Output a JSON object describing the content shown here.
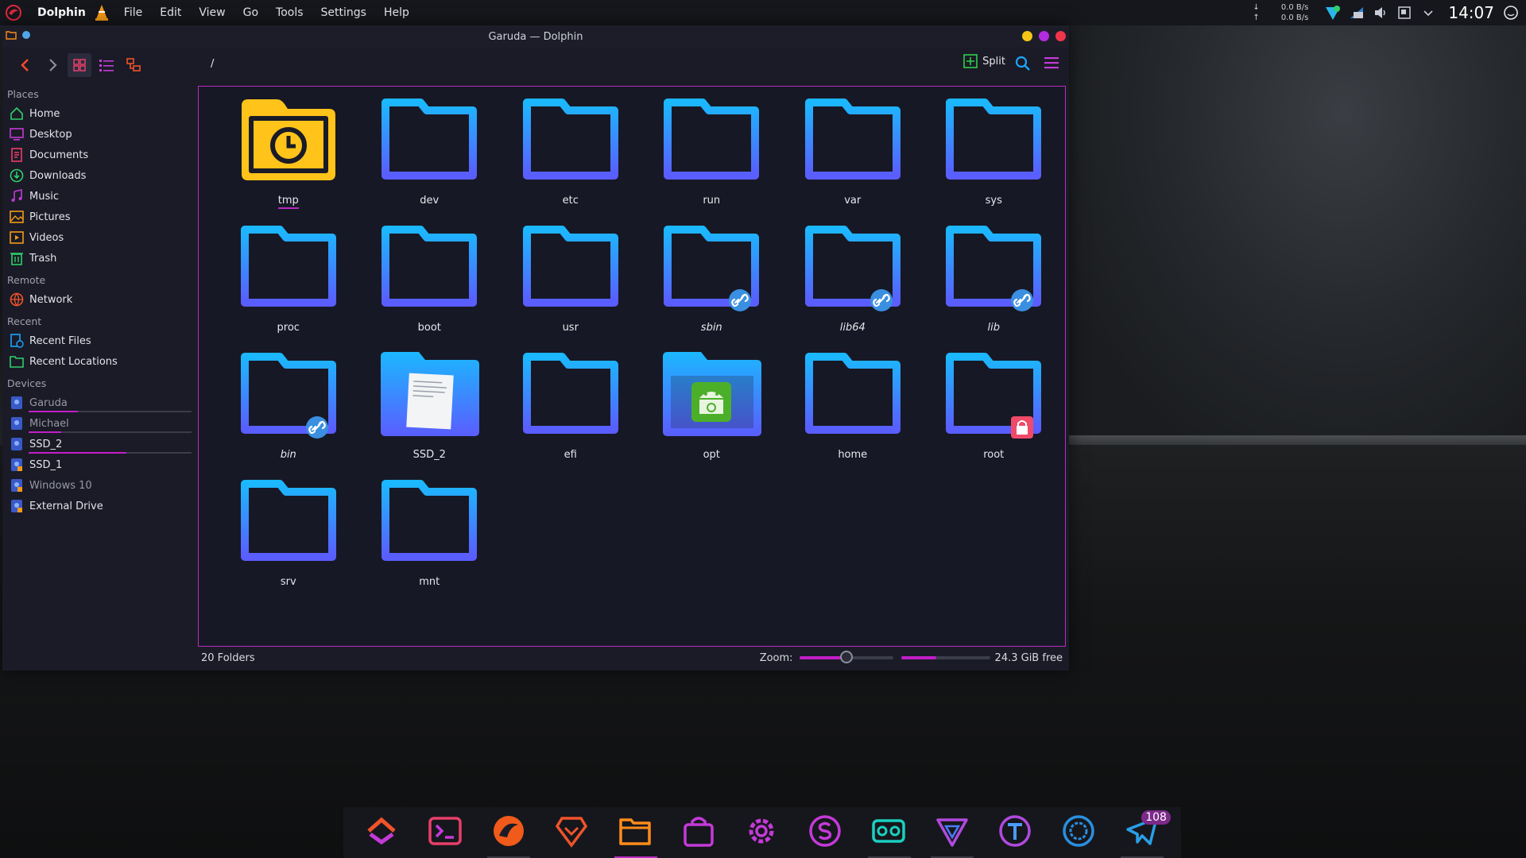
{
  "panel": {
    "app_name": "Dolphin",
    "menu": [
      "File",
      "Edit",
      "View",
      "Go",
      "Tools",
      "Settings",
      "Help"
    ],
    "net_down": "0.0 B/s",
    "net_up": "0.0 B/s",
    "down_arrow": "↓",
    "up_arrow": "↑",
    "clock": "14:07"
  },
  "window": {
    "title": "Garuda — Dolphin",
    "path": "/",
    "split_label": "Split"
  },
  "sidebar": {
    "places_title": "Places",
    "places": [
      {
        "label": "Home",
        "icon": "home-icon"
      },
      {
        "label": "Desktop",
        "icon": "desktop-icon"
      },
      {
        "label": "Documents",
        "icon": "documents-icon"
      },
      {
        "label": "Downloads",
        "icon": "downloads-icon"
      },
      {
        "label": "Music",
        "icon": "music-icon"
      },
      {
        "label": "Pictures",
        "icon": "pictures-icon"
      },
      {
        "label": "Videos",
        "icon": "videos-icon"
      },
      {
        "label": "Trash",
        "icon": "trash-icon"
      }
    ],
    "remote_title": "Remote",
    "remote": [
      {
        "label": "Network",
        "icon": "network-icon"
      }
    ],
    "recent_title": "Recent",
    "recent": [
      {
        "label": "Recent Files",
        "icon": "recent-files-icon"
      },
      {
        "label": "Recent Locations",
        "icon": "recent-locations-icon"
      }
    ],
    "devices_title": "Devices",
    "devices": [
      {
        "label": "Garuda",
        "usage": 0.3
      },
      {
        "label": "Michael",
        "usage": 0.2
      },
      {
        "label": "SSD_2",
        "usage": 0.6
      },
      {
        "label": "SSD_1"
      },
      {
        "label": "Windows 10"
      },
      {
        "label": "External Drive"
      }
    ]
  },
  "folders": [
    {
      "name": "tmp",
      "kind": "tmp"
    },
    {
      "name": "dev",
      "kind": "plain"
    },
    {
      "name": "etc",
      "kind": "plain"
    },
    {
      "name": "run",
      "kind": "plain"
    },
    {
      "name": "var",
      "kind": "plain"
    },
    {
      "name": "sys",
      "kind": "plain"
    },
    {
      "name": "proc",
      "kind": "plain"
    },
    {
      "name": "boot",
      "kind": "plain"
    },
    {
      "name": "usr",
      "kind": "plain"
    },
    {
      "name": "sbin",
      "kind": "link"
    },
    {
      "name": "lib64",
      "kind": "link"
    },
    {
      "name": "lib",
      "kind": "link"
    },
    {
      "name": "bin",
      "kind": "link"
    },
    {
      "name": "SSD_2",
      "kind": "doc"
    },
    {
      "name": "efi",
      "kind": "plain"
    },
    {
      "name": "opt",
      "kind": "android"
    },
    {
      "name": "home",
      "kind": "plain"
    },
    {
      "name": "root",
      "kind": "locked"
    },
    {
      "name": "srv",
      "kind": "plain"
    },
    {
      "name": "mnt",
      "kind": "plain"
    }
  ],
  "status": {
    "count": "20 Folders",
    "zoom_label": "Zoom:",
    "zoom_level": 0.5,
    "space_used": 0.4,
    "free": "24.3 GiB free"
  },
  "dock": {
    "items": [
      {
        "icon": "garuda-welcome-icon"
      },
      {
        "icon": "terminal-icon"
      },
      {
        "icon": "garuda-dragon-icon"
      },
      {
        "icon": "brave-browser-icon"
      },
      {
        "icon": "file-manager-icon",
        "active": true
      },
      {
        "icon": "software-store-icon"
      },
      {
        "icon": "settings-gear-icon"
      },
      {
        "icon": "skype-s-icon"
      },
      {
        "icon": "tape-player-icon"
      },
      {
        "icon": "triangle-app-icon"
      },
      {
        "icon": "typora-t-icon"
      },
      {
        "icon": "steam-icon"
      },
      {
        "icon": "telegram-icon",
        "badge": "108"
      }
    ]
  },
  "colors": {
    "accent": "#b82ac0",
    "folder_top": "#1bb8ff",
    "folder_bottom": "#5a5dff",
    "tmp_folder": "#ffc31a"
  }
}
